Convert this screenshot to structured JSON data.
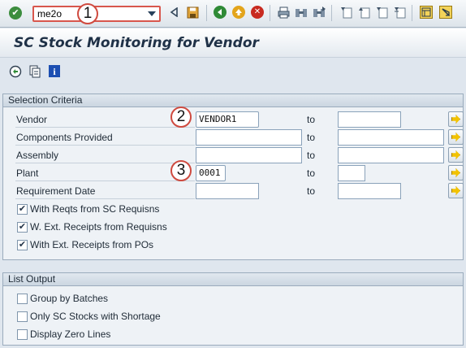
{
  "toolbar": {
    "command_value": "me2o",
    "icons": {
      "enter": "check-icon",
      "back": "back-triangle-icon",
      "save": "save-icon",
      "nav_back": "green-back-icon",
      "nav_exit": "exit-icon",
      "cancel": "cancel-icon",
      "print": "print-icon",
      "find": "find-icon",
      "find_next": "find-next-icon",
      "first_page": "first-page-icon",
      "prev_page": "previous-page-icon",
      "next_page": "next-page-icon",
      "last_page": "last-page-icon",
      "layout": "customize-layout-icon",
      "help": "help-icon"
    }
  },
  "annotations": {
    "one": "1",
    "two": "2",
    "three": "3"
  },
  "page": {
    "title": "SC Stock Monitoring for Vendor"
  },
  "app_toolbar": {
    "icons": [
      "execute-icon",
      "get-variant-icon",
      "info-icon"
    ]
  },
  "selection": {
    "header": "Selection Criteria",
    "to_label": "to",
    "rows": [
      {
        "label": "Vendor",
        "low": "VENDOR1",
        "high": ""
      },
      {
        "label": "Components Provided",
        "low": "",
        "high": ""
      },
      {
        "label": "Assembly",
        "low": "",
        "high": ""
      },
      {
        "label": "Plant",
        "low": "0001",
        "high": ""
      },
      {
        "label": "Requirement Date",
        "low": "",
        "high": ""
      }
    ],
    "checkboxes": [
      {
        "label": "With Reqts from SC Requisns",
        "checked": true,
        "mark": "✔"
      },
      {
        "label": "W. Ext. Receipts from Requisns",
        "checked": true,
        "mark": "✔"
      },
      {
        "label": "With Ext. Receipts from POs",
        "checked": true,
        "mark": "✔"
      }
    ]
  },
  "list_output": {
    "header": "List Output",
    "checkboxes": [
      {
        "label": "Group by Batches",
        "checked": false,
        "mark": ""
      },
      {
        "label": "Only SC Stocks with Shortage",
        "checked": false,
        "mark": ""
      },
      {
        "label": "Display Zero Lines",
        "checked": false,
        "mark": ""
      }
    ]
  },
  "colors": {
    "highlight": "#d8574d",
    "accent_arrow": "#f2c200",
    "background": "#dfe6ee"
  }
}
